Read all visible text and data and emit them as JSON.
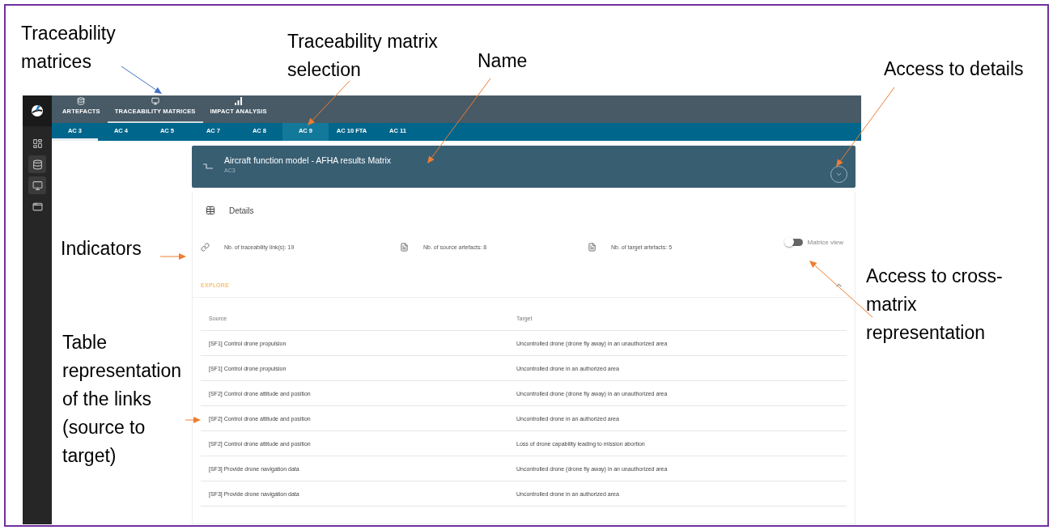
{
  "annotations": [
    {
      "text": "Traceability\nmatrices"
    },
    {
      "text": "Traceability matrix\nselection"
    },
    {
      "text": "Name"
    },
    {
      "text": "Access to details"
    },
    {
      "text": "Indicators"
    },
    {
      "text": "Access to cross-\nmatrix\nrepresentation"
    },
    {
      "text": "Table\nrepresentation\nof the links\n(source to\ntarget)"
    }
  ],
  "sidebar": {
    "items": [
      {
        "kind": "dashboard",
        "selected": false
      },
      {
        "kind": "database",
        "selected": true
      },
      {
        "kind": "monitor",
        "selected": true
      },
      {
        "kind": "card",
        "selected": false
      }
    ]
  },
  "main_tabs": [
    {
      "label": "ARTEFACTS",
      "kind": "database",
      "selected": false
    },
    {
      "label": "TRACEABILITY MATRICES",
      "kind": "monitor",
      "selected": true
    },
    {
      "label": "IMPACT ANALYSIS",
      "kind": "bars",
      "selected": false
    }
  ],
  "matrix_tabs": [
    {
      "label": "AC 3",
      "selected": true,
      "hovered": false
    },
    {
      "label": "AC 4",
      "selected": false,
      "hovered": false
    },
    {
      "label": "AC 5",
      "selected": false,
      "hovered": false
    },
    {
      "label": "AC 7",
      "selected": false,
      "hovered": false
    },
    {
      "label": "AC 8",
      "selected": false,
      "hovered": false
    },
    {
      "label": "AC 9",
      "selected": false,
      "hovered": true
    },
    {
      "label": "AC 10 FTA",
      "selected": false,
      "hovered": false
    },
    {
      "label": "AC 11",
      "selected": false,
      "hovered": false
    }
  ],
  "matrix": {
    "title": "Aircraft function model - AFHA results Matrix",
    "subtitle": "AC3",
    "expanded": false
  },
  "details": {
    "title": "Details",
    "indicators": [
      {
        "kind": "link",
        "text": "Nb. of traceability link(s): 19"
      },
      {
        "kind": "file",
        "text": "Nb. of source artefacts: 8"
      },
      {
        "kind": "file",
        "text": "Nb. of target artefacts: 5"
      }
    ],
    "toggle": {
      "label": "Matrice view",
      "on": false
    },
    "explore": {
      "label": "EXPLORE",
      "expanded": true
    }
  },
  "table": {
    "columns": [
      "Source",
      "Target"
    ],
    "rows": [
      [
        "[SF1] Control drone propulsion",
        "Uncontrolled drone (drone fly away) in an unauthorized area"
      ],
      [
        "[SF1] Control drone propulsion",
        "Uncontrolled drone in an authorized area"
      ],
      [
        "[SF2] Control drone attitude and position",
        "Uncontrolled drone (drone fly away) in an unauthorized area"
      ],
      [
        "[SF2] Control drone attitude and position",
        "Uncontrolled drone in an authorized area"
      ],
      [
        "[SF2] Control drone attitude and position",
        "Loss of drone capability leading to mission abortion"
      ],
      [
        "[SF3] Provide drone navigation data",
        "Uncontrolled drone (drone fly away) in an unauthorized area"
      ],
      [
        "[SF3] Provide drone navigation data",
        "Uncontrolled drone in an authorized area"
      ]
    ]
  }
}
